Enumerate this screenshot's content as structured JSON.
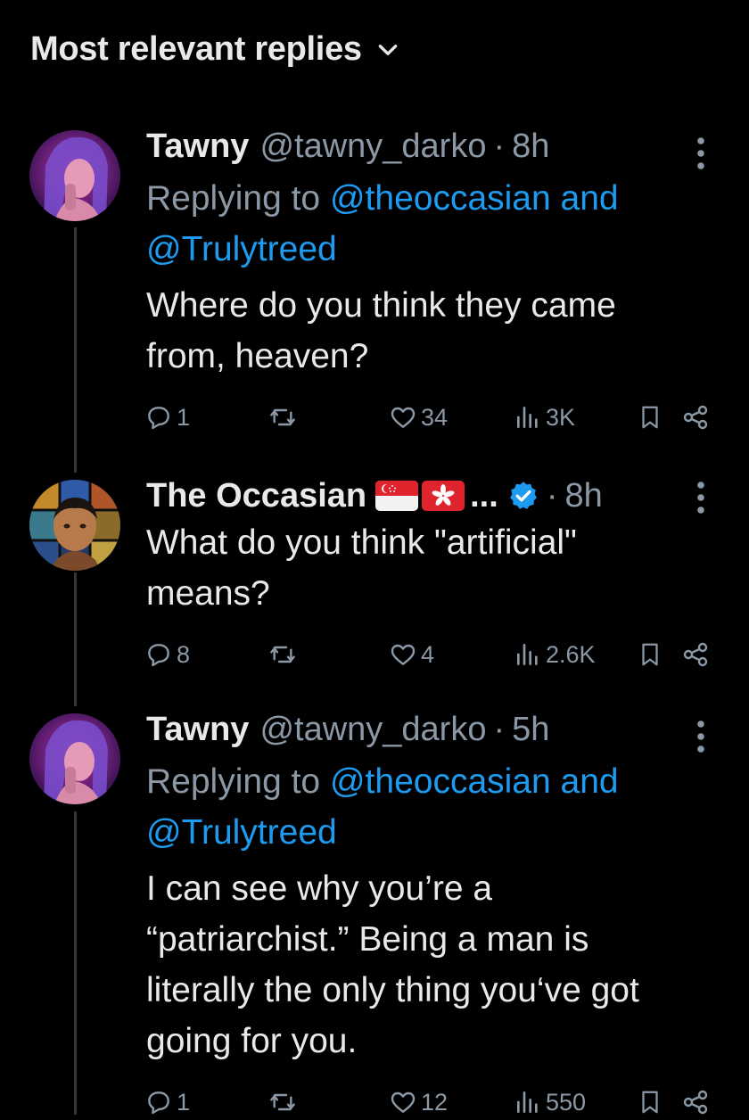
{
  "header": {
    "title": "Most relevant replies",
    "chevron_icon": "chevron-down-icon"
  },
  "replies": [
    {
      "name": "Tawny",
      "handle": "@tawny_darko",
      "time": "8h",
      "replying_prefix": "Replying to ",
      "mention1": "@theoccasian",
      "mention_join": " and",
      "mention2": "@Trulytreed",
      "text": "Where do you think they came\nfrom, heaven?",
      "stats": {
        "replies": "1",
        "reposts": "",
        "likes": "34",
        "views": "3K"
      }
    },
    {
      "name": "The Occasian",
      "handle": "",
      "flags": [
        "flag-singapore-icon",
        "flag-hong-kong-icon"
      ],
      "ellipsis": "...",
      "verified_icon": "verified-badge-icon",
      "time": "8h",
      "text": "What do you think \"artificial\"\nmeans?",
      "stats": {
        "replies": "8",
        "reposts": "",
        "likes": "4",
        "views": "2.6K"
      }
    },
    {
      "name": "Tawny",
      "handle": "@tawny_darko",
      "time": "5h",
      "replying_prefix": "Replying to ",
      "mention1": "@theoccasian",
      "mention_join": " and",
      "mention2": "@Trulytreed",
      "text": "I can see why you’re a\n“patriarchist.” Being a man is\nliterally the only thing you‘ve got\ngoing for you.",
      "stats": {
        "replies": "1",
        "reposts": "",
        "likes": "12",
        "views": "550"
      }
    }
  ],
  "colors": {
    "background": "#000000",
    "text": "#e7e9ea",
    "secondary": "#8b98a5",
    "link": "#1d9bf0",
    "verified": "#1d9bf0"
  }
}
